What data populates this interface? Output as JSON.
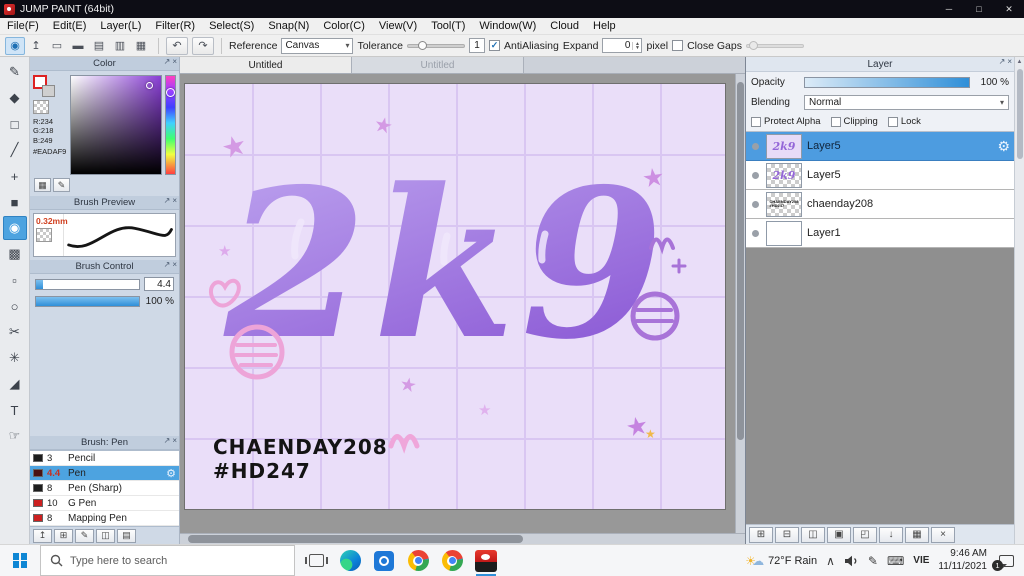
{
  "colors": {
    "accent": "#4DA3E0",
    "selection": "#4D9CE0",
    "canvas_background": "#EADAF9"
  },
  "titlebar": {
    "title": "JUMP PAINT (64bit)",
    "minimize_glyph": "─",
    "maximize_glyph": "□",
    "close_glyph": "✕"
  },
  "menubar": {
    "items": [
      "File(F)",
      "Edit(E)",
      "Layer(L)",
      "Filter(R)",
      "Select(S)",
      "Snap(N)",
      "Color(C)",
      "View(V)",
      "Tool(T)",
      "Window(W)",
      "Cloud",
      "Help"
    ]
  },
  "toolbar": {
    "icons": [
      {
        "name": "brush-cursor",
        "glyph": "◉"
      },
      {
        "name": "publish",
        "glyph": "↥"
      },
      {
        "name": "comment",
        "glyph": "▭"
      },
      {
        "name": "panel",
        "glyph": "▬"
      },
      {
        "name": "document-list",
        "glyph": "▤"
      },
      {
        "name": "pages",
        "glyph": "▥"
      },
      {
        "name": "grid",
        "glyph": "▦"
      }
    ],
    "undo_glyph": "↶",
    "redo_glyph": "↷",
    "reference_label": "Reference",
    "reference_value": "Canvas",
    "tolerance_label": "Tolerance",
    "tolerance_value": "1",
    "antialiasing_label": "AntiAliasing",
    "expand_label": "Expand",
    "expand_value": "0",
    "expand_unit": "pixel",
    "close_gaps_label": "Close Gaps"
  },
  "tools": [
    {
      "name": "pen-tool",
      "glyph": "✎"
    },
    {
      "name": "eraser-tool",
      "glyph": "◆"
    },
    {
      "name": "select-rect-tool",
      "glyph": "□"
    },
    {
      "name": "line-tool",
      "glyph": "╱"
    },
    {
      "name": "move-tool",
      "glyph": "+"
    },
    {
      "name": "shape-tool",
      "glyph": "■"
    },
    {
      "name": "fill-tool",
      "glyph": "◉"
    },
    {
      "name": "gradient-tool",
      "glyph": "▩"
    },
    {
      "name": "marquee-tool",
      "glyph": "▫"
    },
    {
      "name": "lasso-tool",
      "glyph": "○"
    },
    {
      "name": "knife-tool",
      "glyph": "✂"
    },
    {
      "name": "wand-tool",
      "glyph": "✳"
    },
    {
      "name": "eyedropper-tool",
      "glyph": "◢"
    },
    {
      "name": "text-tool",
      "glyph": "T"
    },
    {
      "name": "hand-tool",
      "glyph": "☞"
    }
  ],
  "color_panel": {
    "title": "Color",
    "r": "R:234",
    "g": "G:218",
    "b": "B:249",
    "hex": "#EADAF9"
  },
  "brush_preview": {
    "title": "Brush Preview",
    "size": "0.32mm"
  },
  "brush_control": {
    "title": "Brush Control",
    "size_value": "4.4",
    "opacity_value": "100 %"
  },
  "brush_panel": {
    "title": "Brush: Pen",
    "items": [
      {
        "size": "3",
        "name": "Pencil"
      },
      {
        "size": "4.4",
        "name": "Pen"
      },
      {
        "size": "8",
        "name": "Pen (Sharp)"
      },
      {
        "size": "10",
        "name": "G Pen"
      },
      {
        "size": "8",
        "name": "Mapping Pen"
      }
    ],
    "buttons": [
      {
        "name": "sync-brush",
        "glyph": "↥"
      },
      {
        "name": "new-brush",
        "glyph": "⊞"
      },
      {
        "name": "edit-brush",
        "glyph": "✎"
      },
      {
        "name": "duplicate-brush",
        "glyph": "◫"
      },
      {
        "name": "brush-folder",
        "glyph": "▤"
      }
    ]
  },
  "canvas": {
    "tabs": [
      "Untitled",
      "Untitled"
    ],
    "artwork": {
      "main_text": "2k9",
      "signature_line1": "CHAENDAY208",
      "signature_line2": "#HD247"
    }
  },
  "layer_panel": {
    "title": "Layer",
    "opacity_label": "Opacity",
    "opacity_value": "100 %",
    "blending_label": "Blending",
    "blending_value": "Normal",
    "protect_alpha_label": "Protect Alpha",
    "clipping_label": "Clipping",
    "lock_label": "Lock",
    "layers": [
      {
        "name": "Layer5"
      },
      {
        "name": "Layer5"
      },
      {
        "name": "chaenday208"
      },
      {
        "name": "Layer1"
      }
    ],
    "buttons": [
      {
        "name": "new-layer",
        "glyph": "⊞"
      },
      {
        "name": "new-folder",
        "glyph": "⊟"
      },
      {
        "name": "duplicate-layer",
        "glyph": "◫"
      },
      {
        "name": "layer-folder",
        "glyph": "▣"
      },
      {
        "name": "clipping",
        "glyph": "◰"
      },
      {
        "name": "merge-down",
        "glyph": "↓"
      },
      {
        "name": "material",
        "glyph": "▦"
      },
      {
        "name": "delete-layer",
        "glyph": "×"
      }
    ]
  },
  "taskbar": {
    "search_placeholder": "Type here to search",
    "weather": "72°F Rain",
    "chevron_glyph": "∧",
    "pen_glyph": "✎",
    "keyboard_glyph": "⌨",
    "language": "VIE",
    "time": "9:46 AM",
    "date": "11/11/2021",
    "notification_count": "1"
  }
}
